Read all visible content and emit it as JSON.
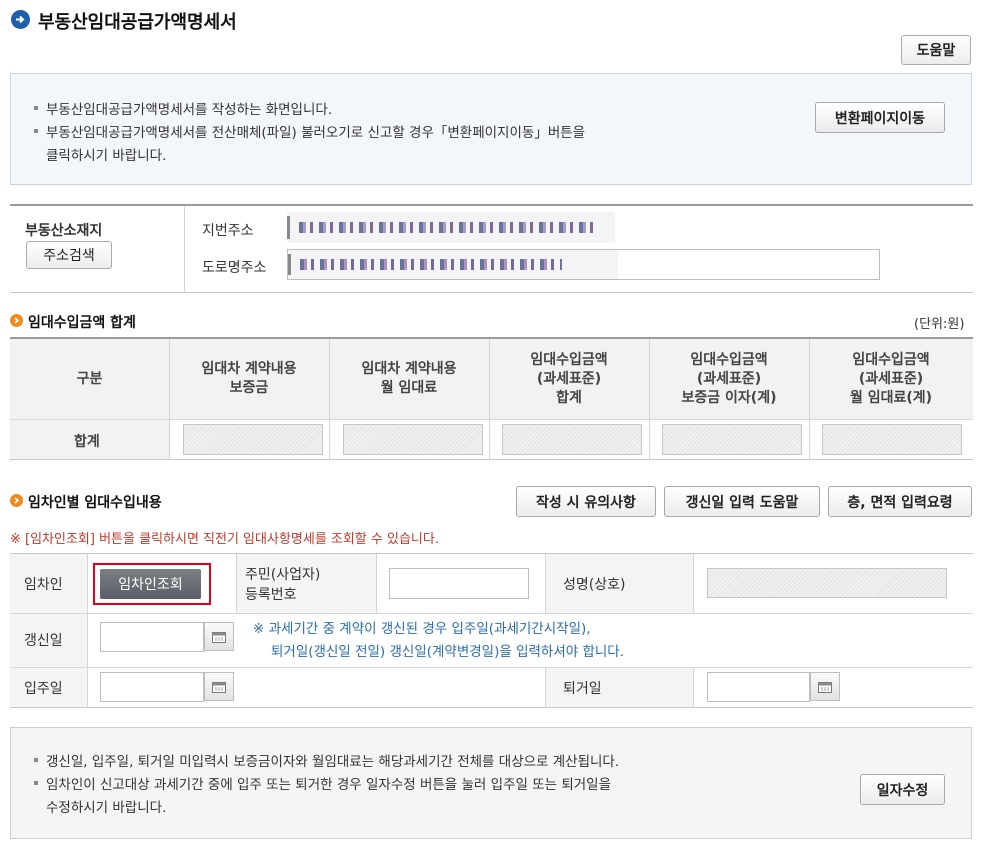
{
  "page": {
    "title": "부동산임대공급가액명세서"
  },
  "toolbar": {
    "help_label": "도움말"
  },
  "intro": {
    "line1": "부동산임대공급가액명세서를 작성하는 화면입니다.",
    "line2": "부동산임대공급가액명세서를 전산매체(파일) 불러오기로 신고할 경우「변환페이지이동」버튼을",
    "line2b": "클릭하시기 바랍니다.",
    "convert_button": "변환페이지이동"
  },
  "address": {
    "label": "부동산소재지",
    "search_button": "주소검색",
    "lot_label": "지번주소",
    "road_label": "도로명주소"
  },
  "total_section": {
    "title": "임대수입금액 합계",
    "unit": "(단위:원)",
    "headers": [
      "구분",
      "임대차 계약내용\n보증금",
      "임대차 계약내용\n월 임대료",
      "임대수입금액\n(과세표준)\n합계",
      "임대수입금액\n(과세표준)\n보증금 이자(계)",
      "임대수입금액\n(과세표준)\n월 임대료(계)"
    ],
    "row_label": "합계"
  },
  "tenant_section": {
    "title": "임차인별 임대수입내용",
    "btn_caution": "작성 시 유의사항",
    "btn_renewal_help": "갱신일 입력 도움말",
    "btn_floor_area": "층, 면적 입력요령",
    "notice": "※ [임차인조회] 버튼을 클릭하시면 직전기 임대사항명세를 조회할 수 있습니다.",
    "tenant_label": "임차인",
    "tenant_lookup_button": "임차인조회",
    "id_label_1": "주민(사업자)",
    "id_label_2": "등록번호",
    "name_label": "성명(상호)",
    "renewal_label": "갱신일",
    "renewal_note_1": "※ 과세기간 중 계약이 갱신된 경우 입주일(과세기간시작일),",
    "renewal_note_2": "퇴거일(갱신일 전일) 갱신일(계약변경일)을 입력하셔야 합니다.",
    "move_in_label": "입주일",
    "move_out_label": "퇴거일"
  },
  "bottom_info": {
    "line1": "갱신일, 입주일, 퇴거일 미입력시 보증금이자와 월임대료는 해당과세기간 전체를 대상으로 계산됩니다.",
    "line2": "임차인이 신고대상 과세기간 중에 입주 또는 퇴거한 경우 일자수정 버튼을 눌러 입주일 또는 퇴거일을",
    "line2b": "수정하시기 바랍니다.",
    "fix_date_button": "일자수정"
  },
  "colors": {
    "accent": "#1d5fa8",
    "highlight": "#e0001b",
    "section_icon": "#f08a1c",
    "note_red": "#c0392b",
    "note_blue": "#2a6db0"
  },
  "icons": [
    "arrow-right-icon",
    "section-bullet-icon",
    "calendar-icon"
  ]
}
